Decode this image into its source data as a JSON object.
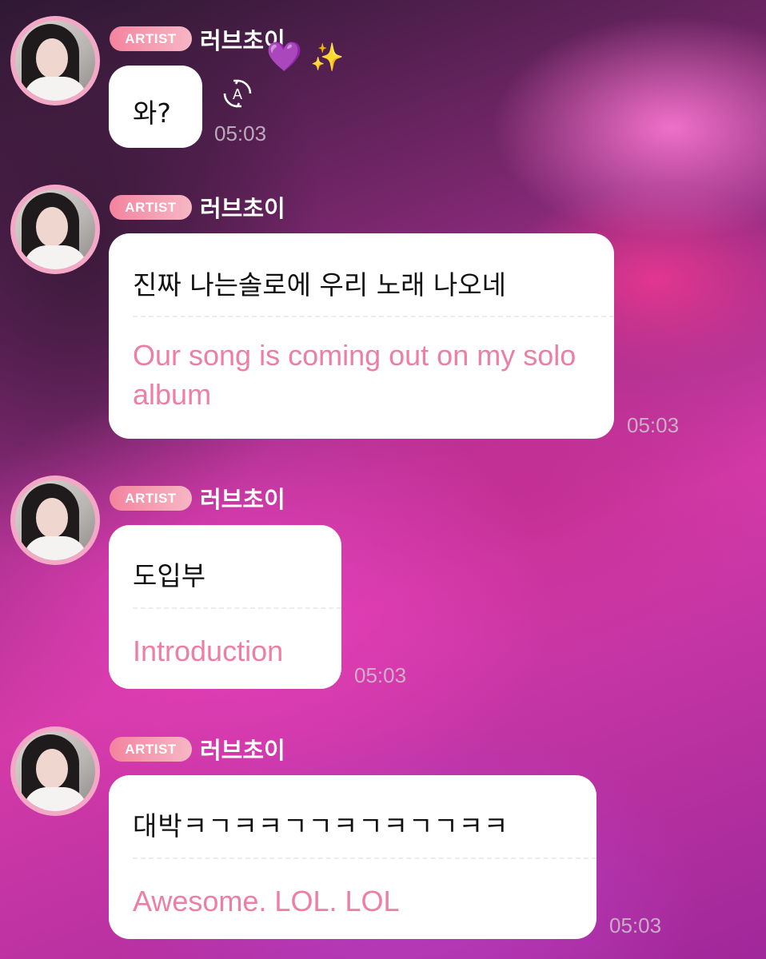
{
  "messages": [
    {
      "badge": "ARTIST",
      "name": "러브초이",
      "name_emojis": "💜✨",
      "korean": "와?",
      "translate_icon": "translate-icon",
      "time": "05:03"
    },
    {
      "badge": "ARTIST",
      "name": "러브초이",
      "korean": "진짜 나는솔로에 우리 노래 나오네",
      "english": "Our song is coming out on my solo album",
      "time": "05:03"
    },
    {
      "badge": "ARTIST",
      "name": "러브초이",
      "korean": "도입부",
      "english": "Introduction",
      "time": "05:03"
    },
    {
      "badge": "ARTIST",
      "name": "러브초이",
      "korean": "대박ㅋㄱㅋㅋㄱㄱㅋㄱㅋㄱㄱㅋㅋ",
      "english": "Awesome. LOL. LOL",
      "time": "05:03"
    }
  ],
  "colors": {
    "badge_from": "#f4839f",
    "badge_to": "#f6b7c4",
    "translation_text": "#ec7fa3",
    "bubble": "#ffffff",
    "avatar_ring": "#f3a8c6"
  }
}
